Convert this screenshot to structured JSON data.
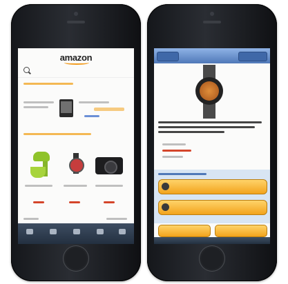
{
  "home_screen": {
    "logo_text": "amazon",
    "accent_color": "#f29b1d"
  },
  "product_screen": {
    "nav_color": "#4f78b8",
    "button_color": "#f2a31c"
  }
}
